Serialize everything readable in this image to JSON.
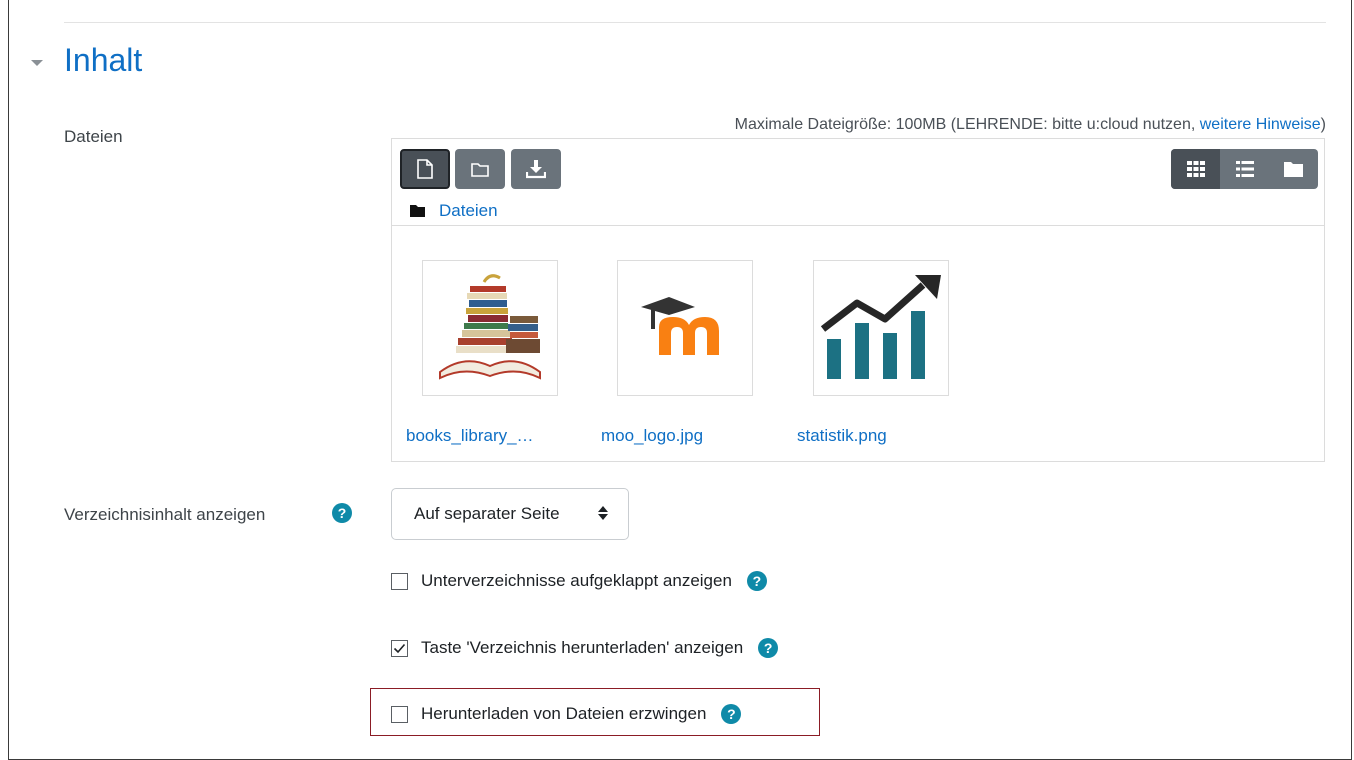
{
  "section": {
    "title": "Inhalt",
    "toggle_icon": "triangle-down-icon"
  },
  "files": {
    "label": "Dateien",
    "max_size_text": "Maximale Dateigröße: 100MB (LEHRENDE: bitte u:cloud nutzen, ",
    "max_size_link": "weitere Hinweise",
    "max_size_close": ")",
    "toolbar": [
      "file-add-icon",
      "folder-create-icon",
      "download-icon"
    ],
    "views": [
      "grid-view-icon",
      "list-view-icon",
      "tree-view-icon"
    ],
    "breadcrumb": "Dateien",
    "items": [
      {
        "name": "books_library_…",
        "thumb": "books-thumbnail"
      },
      {
        "name": "moo_logo.jpg",
        "thumb": "moodle-logo-thumbnail"
      },
      {
        "name": "statistik.png",
        "thumb": "statistics-chart-thumbnail"
      }
    ]
  },
  "display": {
    "label": "Verzeichnisinhalt anzeigen",
    "selected": "Auf separater Seite"
  },
  "options": [
    {
      "label": "Unterverzeichnisse aufgeklappt anzeigen",
      "checked": false
    },
    {
      "label": "Taste 'Verzeichnis herunterladen' anzeigen",
      "checked": true
    },
    {
      "label": "Herunterladen von Dateien erzwingen",
      "checked": false
    }
  ],
  "help_glyph": "?",
  "colors": {
    "link": "#0f6fc5",
    "help": "#0f8aa8",
    "highlight": "#8b1c25"
  }
}
